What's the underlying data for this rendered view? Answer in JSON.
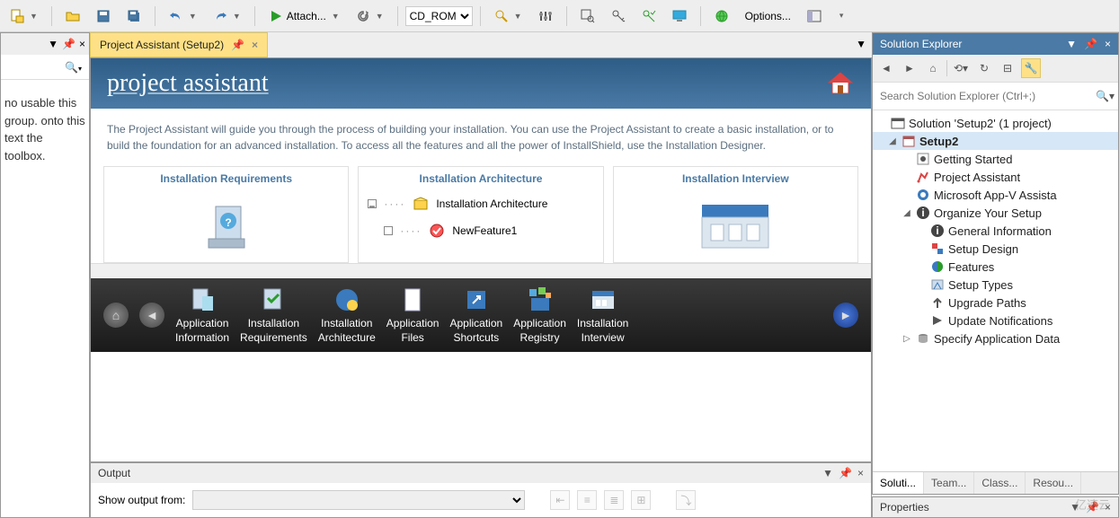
{
  "toolbar": {
    "attach_label": "Attach...",
    "config_dd": "CD_ROM",
    "options_label": "Options..."
  },
  "left_panel": {
    "text": "no usable this group. onto this text the toolbox."
  },
  "tab": {
    "title": "Project Assistant (Setup2)"
  },
  "pa": {
    "title": "project assistant",
    "desc": "The Project Assistant will guide you through the process of building your installation. You can use the Project Assistant to create a basic installation, or to build the foundation for an advanced installation. To access all the features and all the power of InstallShield, use the Installation Designer.",
    "col1": "Installation Requirements",
    "col2": "Installation Architecture",
    "col3": "Installation Interview",
    "arch_item1": "Installation Architecture",
    "arch_item2": "NewFeature1",
    "steps": [
      {
        "l1": "Application",
        "l2": "Information"
      },
      {
        "l1": "Installation",
        "l2": "Requirements"
      },
      {
        "l1": "Installation",
        "l2": "Architecture"
      },
      {
        "l1": "Application",
        "l2": "Files"
      },
      {
        "l1": "Application",
        "l2": "Shortcuts"
      },
      {
        "l1": "Application",
        "l2": "Registry"
      },
      {
        "l1": "Installation",
        "l2": "Interview"
      }
    ]
  },
  "output": {
    "title": "Output",
    "show_label": "Show output from:"
  },
  "sol": {
    "title": "Solution Explorer",
    "search_ph": "Search Solution Explorer (Ctrl+;)",
    "root": "Solution 'Setup2' (1 project)",
    "proj": "Setup2",
    "items": [
      "Getting Started",
      "Project Assistant",
      "Microsoft App-V Assista",
      "Organize Your Setup",
      "General Information",
      "Setup Design",
      "Features",
      "Setup Types",
      "Upgrade Paths",
      "Update Notifications",
      "Specify Application Data"
    ],
    "tabs": [
      "Soluti...",
      "Team...",
      "Class...",
      "Resou..."
    ]
  },
  "props": {
    "title": "Properties"
  },
  "watermark": "亿速云"
}
